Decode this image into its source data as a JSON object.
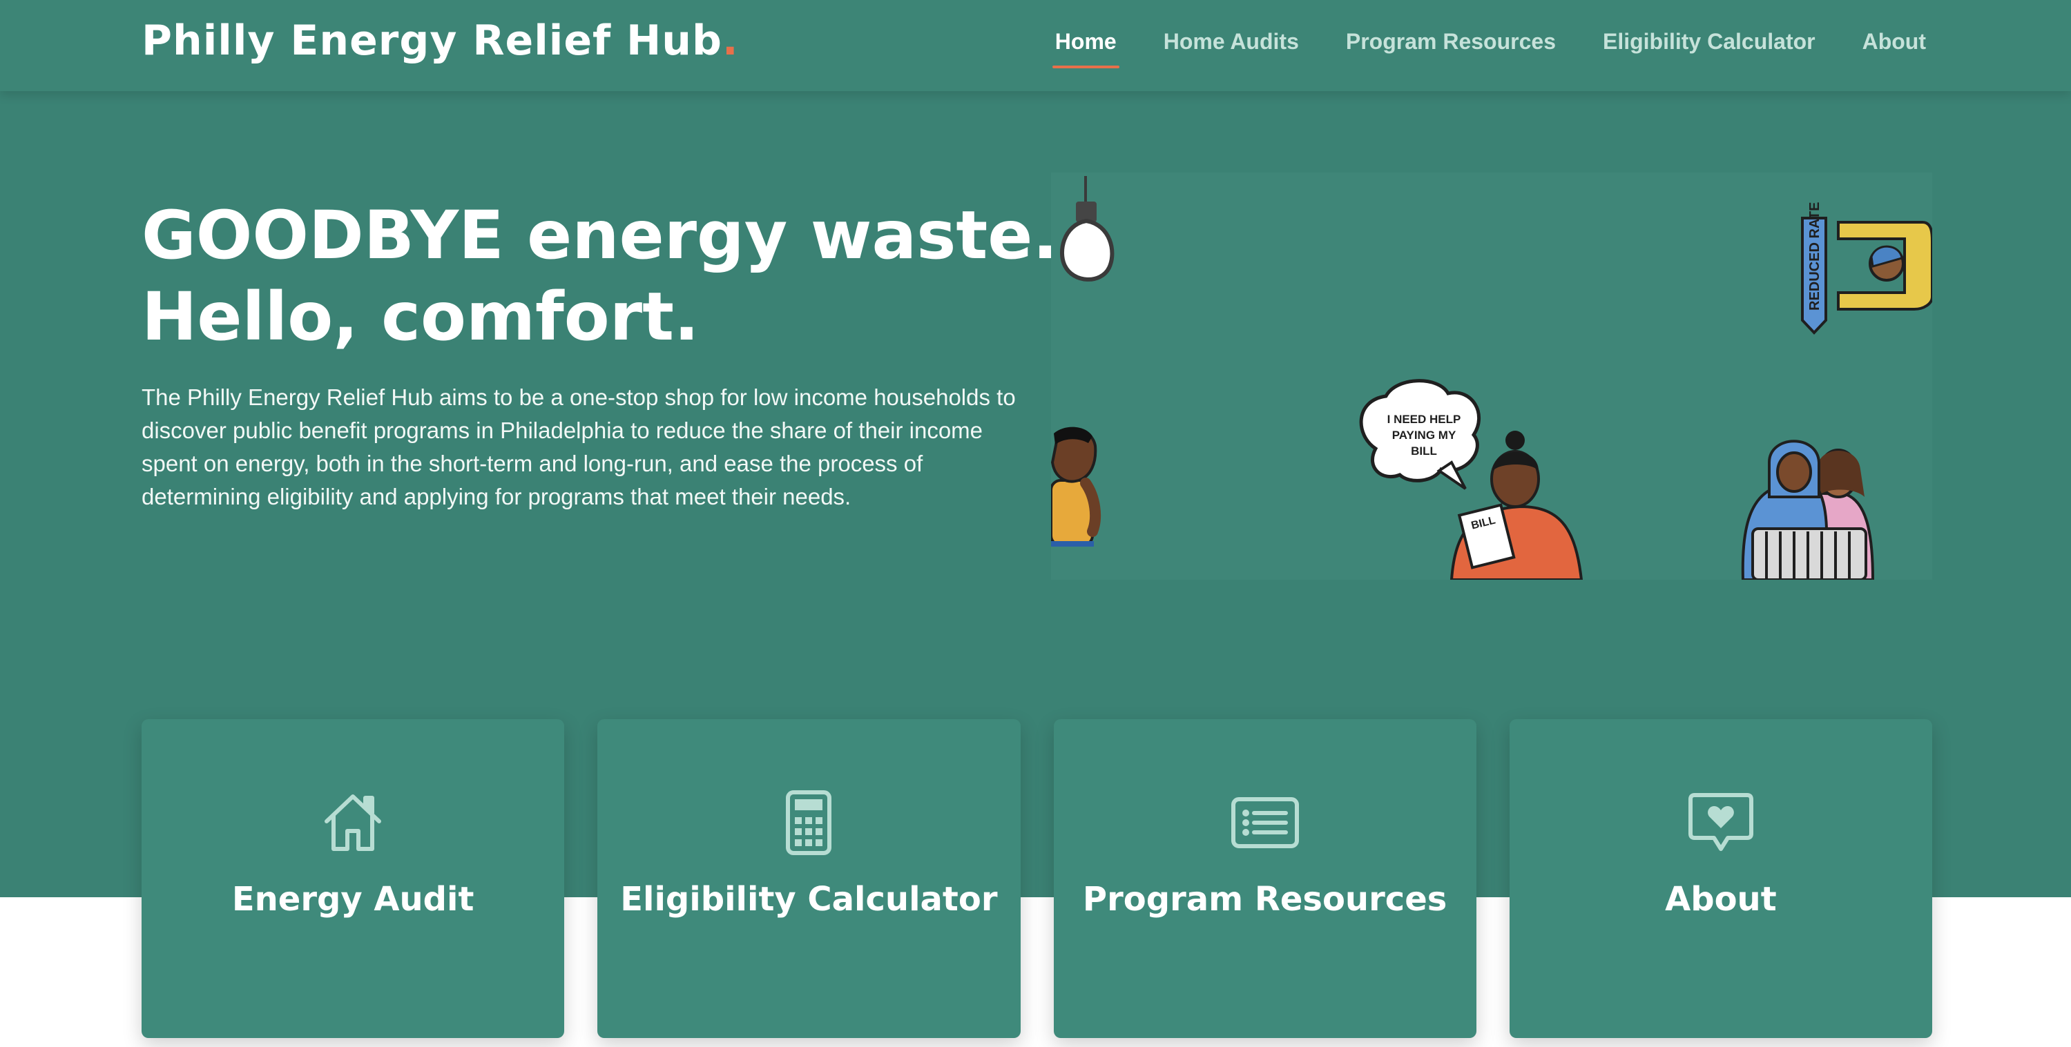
{
  "header": {
    "brand": "Philly Energy Relief Hub",
    "brand_dot": ".",
    "nav": [
      {
        "label": "Home",
        "active": true
      },
      {
        "label": "Home Audits",
        "active": false
      },
      {
        "label": "Program Resources",
        "active": false
      },
      {
        "label": "Eligibility Calculator",
        "active": false
      },
      {
        "label": "About",
        "active": false
      }
    ]
  },
  "hero": {
    "title_line1": "GOODBYE energy waste.",
    "title_line2": "Hello, comfort.",
    "description": "The Philly Energy Relief Hub aims to be a one-stop shop for low income households to discover public benefit programs in Philadelphia to reduce the share of their income spent on energy, both in the short-term and long-run, and ease the process of determining eligibility and applying for programs that meet their needs.",
    "illustration": {
      "speech_bubble": [
        "I NEED HELP",
        "PAYING MY",
        "BILL"
      ],
      "paper_label": "BILL",
      "sign_label": "REDUCED RATE"
    }
  },
  "cards": [
    {
      "label": "Energy Audit",
      "icon": "house-icon"
    },
    {
      "label": "Eligibility Calculator",
      "icon": "calculator-icon"
    },
    {
      "label": "Program Resources",
      "icon": "list-icon"
    },
    {
      "label": "About",
      "icon": "heart-message-icon"
    }
  ],
  "colors": {
    "teal": "#3b8274",
    "card": "#3f8a7b",
    "accent": "#e8704a",
    "nav_inactive": "#c6e2da"
  }
}
